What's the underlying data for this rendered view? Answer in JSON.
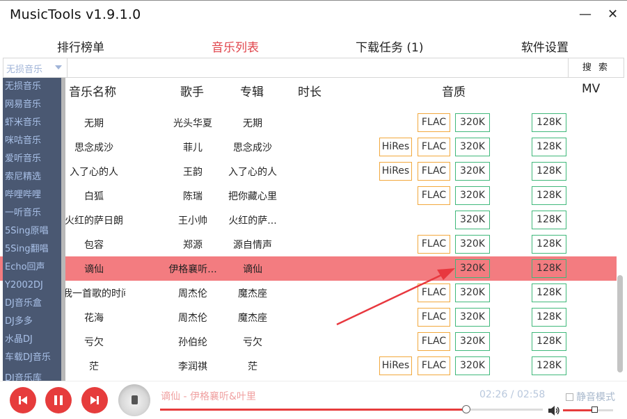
{
  "window": {
    "title": "MusicTools v1.9.1.0",
    "minimize": "—",
    "close": "✕"
  },
  "tabs": [
    {
      "label": "排行榜单",
      "active": false
    },
    {
      "label": "音乐列表",
      "active": true
    },
    {
      "label": "下载任务 (1)",
      "active": false
    },
    {
      "label": "软件设置",
      "active": false
    }
  ],
  "search": {
    "source_selected": "无损音乐",
    "query": "",
    "button": "搜 索"
  },
  "sources": [
    "无损音乐",
    "网易音乐",
    "虾米音乐",
    "咪咕音乐",
    "爱听音乐",
    "索尼精选",
    "哔哩哔哩",
    "一听音乐",
    "5Sing原唱",
    "5Sing翻唱",
    "Echo回声",
    "Y2002DJ",
    "DJ音乐盒",
    "DJ多多",
    "水晶DJ",
    "车载DJ音乐",
    "DJ音乐库"
  ],
  "columns": {
    "name": "音乐名称",
    "artist": "歌手",
    "album": "专辑",
    "duration": "时长",
    "quality": "音质",
    "mv": "MV"
  },
  "songs": [
    {
      "name": "无期",
      "artist": "光头华夏",
      "album": "无期",
      "hires": "",
      "flac": "FLAC",
      "q320": "320K",
      "mv": "128K"
    },
    {
      "name": "思念成沙",
      "artist": "菲儿",
      "album": "思念成沙",
      "hires": "HiRes",
      "flac": "FLAC",
      "q320": "320K",
      "mv": "128K"
    },
    {
      "name": "入了心的人",
      "artist": "王韵",
      "album": "入了心的人",
      "hires": "HiRes",
      "flac": "FLAC",
      "q320": "320K",
      "mv": "128K"
    },
    {
      "name": "白狐",
      "artist": "陈瑞",
      "album": "把你藏心里",
      "hires": "",
      "flac": "FLAC",
      "q320": "320K",
      "mv": "128K"
    },
    {
      "name": "火红的萨日朗",
      "artist": "王小帅",
      "album": "火红的萨...",
      "hires": "",
      "flac": "",
      "q320": "320K",
      "mv": "128K"
    },
    {
      "name": "包容",
      "artist": "郑源",
      "album": "源自情声",
      "hires": "",
      "flac": "FLAC",
      "q320": "320K",
      "mv": "128K"
    },
    {
      "name": "谪仙",
      "artist": "伊格襄听...",
      "album": "谪仙",
      "hires": "",
      "flac": "",
      "q320": "320K",
      "mv": "128K"
    },
    {
      "name": "我一首歌的时间",
      "artist": "周杰伦",
      "album": "魔杰座",
      "hires": "",
      "flac": "FLAC",
      "q320": "320K",
      "mv": "128K"
    },
    {
      "name": "花海",
      "artist": "周杰伦",
      "album": "魔杰座",
      "hires": "",
      "flac": "FLAC",
      "q320": "320K",
      "mv": "128K"
    },
    {
      "name": "亏欠",
      "artist": "孙伯纶",
      "album": "亏欠",
      "hires": "",
      "flac": "FLAC",
      "q320": "320K",
      "mv": "128K"
    },
    {
      "name": "茫",
      "artist": "李润祺",
      "album": "茫",
      "hires": "HiRes",
      "flac": "FLAC",
      "q320": "320K",
      "mv": "128K"
    }
  ],
  "highlighted_song_index": 6,
  "player": {
    "now_playing": "谪仙 - 伊格襄听&叶里",
    "time": "02:26 / 02:58",
    "progress": 0.8,
    "volume": 0.63,
    "silent_mode_label": "静音模式",
    "silent_mode_checked": false
  },
  "colors": {
    "accent": "#e63c3c",
    "tab_active": "#e0444b",
    "highlight_row": "#f37c80",
    "dropdown_bg": "#4a5872",
    "badge_orange": "#f2a83c",
    "badge_green": "#3fb87a"
  }
}
